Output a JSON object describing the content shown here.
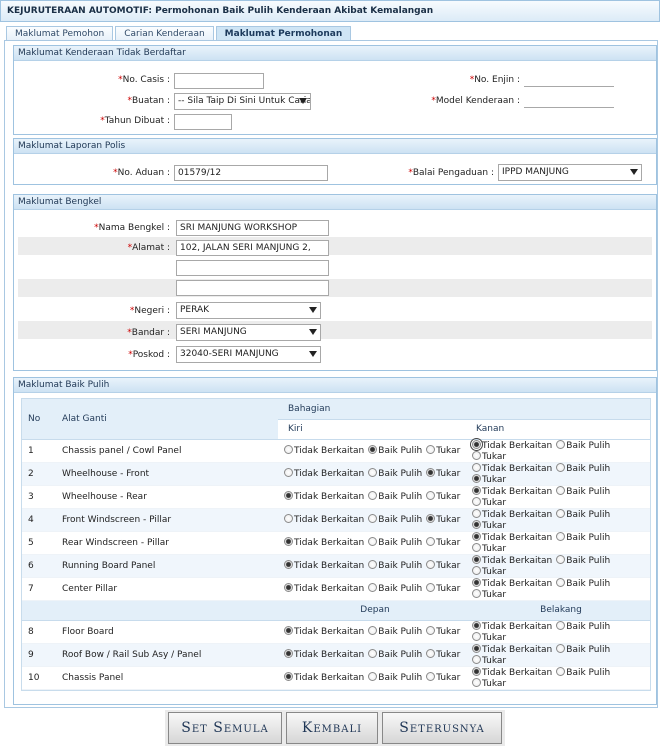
{
  "title": "KEJURUTERAAN AUTOMOTIF: Permohonan Baik Pulih Kenderaan Akibat Kemalangan",
  "tabs": [
    "Maklumat Pemohon",
    "Carian Kenderaan",
    "Maklumat Permohonan"
  ],
  "sec1": {
    "header": "Maklumat Kenderaan Tidak Berdaftar",
    "chasis_label": "No. Casis :",
    "buatan_label": "Buatan :",
    "buatan_value": "-- Sila Taip Di Sini Untuk Carian --",
    "tahun_label": "Tahun Dibuat :",
    "enjin_label": "No. Enjin :",
    "model_label": "Model Kenderaan :"
  },
  "sec2": {
    "header": "Maklumat Laporan Polis",
    "aduan_label": "No. Aduan :",
    "aduan_value": "01579/12",
    "balai_label": "Balai Pengaduan :",
    "balai_value": "IPPD MANJUNG"
  },
  "sec3": {
    "header": "Maklumat Bengkel",
    "nama_label": "Nama Bengkel :",
    "nama_value": "SRI MANJUNG WORKSHOP",
    "alamat_label": "Alamat :",
    "alamat1": "102, JALAN SERI MANJUNG 2,",
    "alamat2": "",
    "alamat3": "",
    "negeri_label": "Negeri :",
    "negeri_value": "PERAK",
    "bandar_label": "Bandar :",
    "bandar_value": "SERI MANJUNG",
    "poskod_label": "Poskod :",
    "poskod_value": "32040-SERI MANJUNG"
  },
  "sec4": {
    "header": "Maklumat Baik Pulih",
    "col_no": "No",
    "col_alat": "Alat Ganti",
    "col_bahagian": "Bahagian",
    "col_kiri": "Kiri",
    "col_kanan": "Kanan",
    "col_depan": "Depan",
    "col_belakang": "Belakang",
    "opt1": "Tidak Berkaitan",
    "opt2": "Baik Pulih",
    "opt3": "Tukar",
    "rows": [
      {
        "no": "1",
        "name": "Chassis panel / Cowl Panel",
        "left": "Baik Pulih",
        "right": "Tidak Berkaitan"
      },
      {
        "no": "2",
        "name": "Wheelhouse - Front",
        "left": "Tukar",
        "right": "Tukar"
      },
      {
        "no": "3",
        "name": "Wheelhouse - Rear",
        "left": "Tidak Berkaitan",
        "right": "Tidak Berkaitan"
      },
      {
        "no": "4",
        "name": "Front Windscreen - Pillar",
        "left": "Tukar",
        "right": "Tukar"
      },
      {
        "no": "5",
        "name": "Rear Windscreen - Pillar",
        "left": "Tidak Berkaitan",
        "right": "Tidak Berkaitan"
      },
      {
        "no": "6",
        "name": "Running Board Panel",
        "left": "Tidak Berkaitan",
        "right": "Tidak Berkaitan"
      },
      {
        "no": "7",
        "name": "Center Pillar",
        "left": "Tidak Berkaitan",
        "right": "Tidak Berkaitan"
      }
    ],
    "rows2": [
      {
        "no": "8",
        "name": "Floor Board",
        "left": "Tidak Berkaitan",
        "right": "Tidak Berkaitan"
      },
      {
        "no": "9",
        "name": "Roof Bow / Rail Sub Asy / Panel",
        "left": "Tidak Berkaitan",
        "right": "Tidak Berkaitan"
      },
      {
        "no": "10",
        "name": "Chassis Panel",
        "left": "Tidak Berkaitan",
        "right": "Tidak Berkaitan"
      }
    ]
  },
  "buttons": {
    "reset": "Set Semula",
    "back": "Kembali",
    "next": "Seterusnya"
  }
}
